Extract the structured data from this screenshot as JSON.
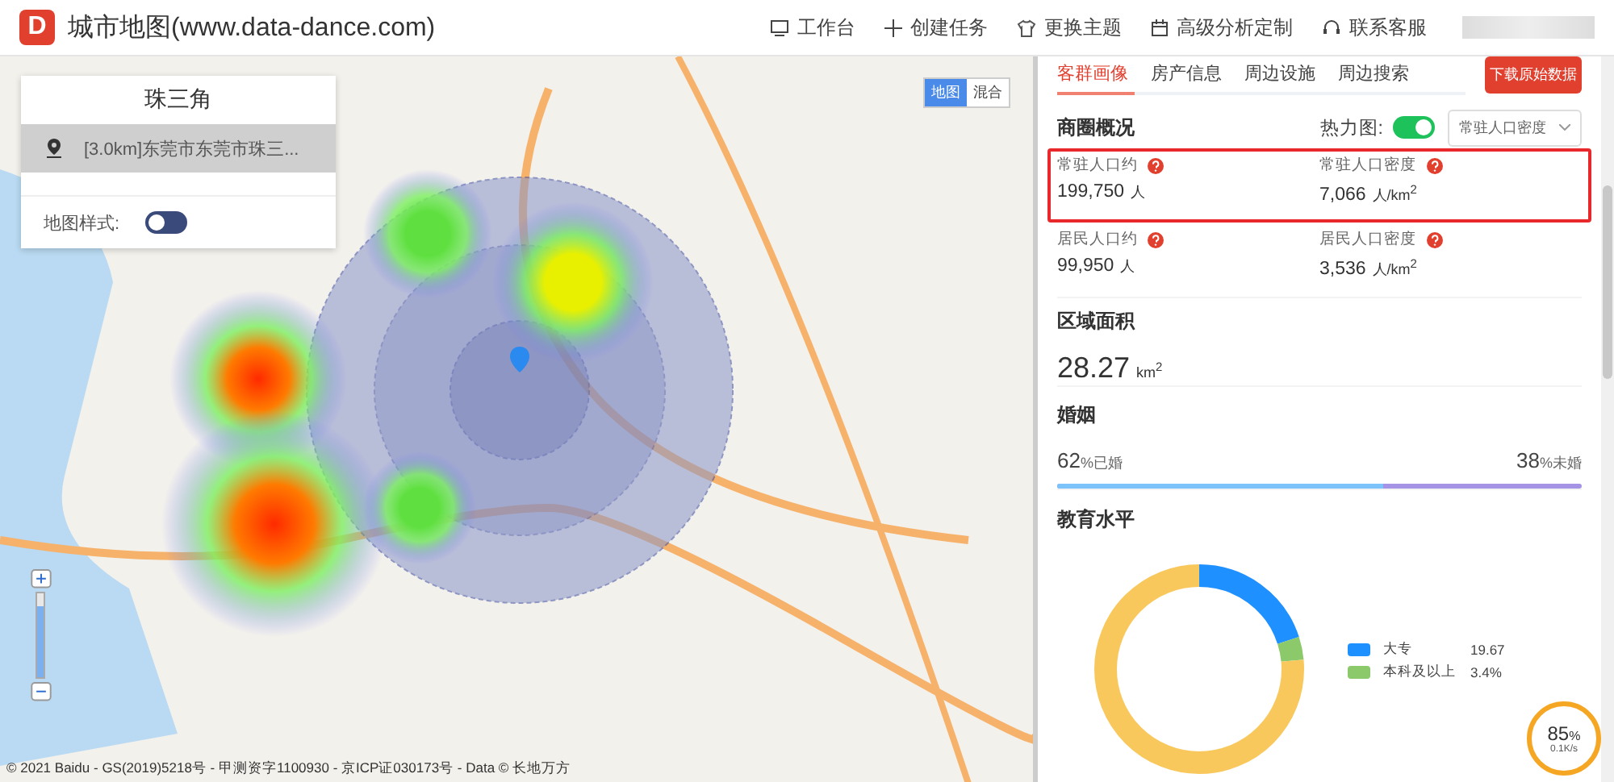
{
  "header": {
    "logo": "D",
    "title": "城市地图(www.data-dance.com)",
    "nav": [
      {
        "kind": "monitor",
        "label": "工作台"
      },
      {
        "kind": "plus",
        "label": "创建任务"
      },
      {
        "kind": "shirt",
        "label": "更换主题"
      },
      {
        "kind": "calendar",
        "label": "高级分析定制"
      },
      {
        "kind": "headset",
        "label": "联系客服"
      }
    ]
  },
  "map_panel": {
    "title": "珠三角",
    "items": [
      {
        "label": "[3.0km]东莞市东莞市珠三...",
        "selected": true
      }
    ],
    "style_label": "地图样式:",
    "style_toggle": {
      "on": false
    }
  },
  "zoom": {
    "level": 0.85
  },
  "map_type": [
    {
      "label": "地图",
      "selected": true
    },
    {
      "label": "混合",
      "selected": false
    }
  ],
  "copyright": "© 2021 Baidu - GS(2019)5218号 - 甲测资字1100930 - 京ICP证030173号 - Data © 长地万方",
  "sidebar": {
    "tabs": [
      {
        "label": "客群画像",
        "selected": true
      },
      {
        "label": "房产信息",
        "selected": false
      },
      {
        "label": "周边设施",
        "selected": false
      },
      {
        "label": "周边搜索",
        "selected": false
      }
    ],
    "download": "下载原始数据",
    "overview": {
      "title": "商圈概况",
      "heat_label": "热力图:",
      "heat_toggle": {
        "on": true
      },
      "heat_select": "常驻人口密度",
      "stats": [
        {
          "label": "常驻人口约",
          "value": "199,750",
          "unit": "人",
          "highlighted": true
        },
        {
          "label": "常驻人口密度",
          "value": "7,066",
          "unit": "人/km$^{2}$",
          "highlighted": true
        },
        {
          "label": "居民人口约",
          "value": "99,950",
          "unit": "人",
          "highlighted": false
        },
        {
          "label": "居民人口密度",
          "value": "3,536",
          "unit": "人/km$^{2}$",
          "highlighted": false
        }
      ]
    },
    "area": {
      "title": "区域面积",
      "value": "28.27",
      "unit": "km$^{2}$"
    },
    "marriage": {
      "title": "婚姻",
      "left_value": "62",
      "left_label": "%已婚",
      "right_value": "38",
      "right_label": "%未婚",
      "level": 0.62
    },
    "education": {
      "title": "教育水平",
      "legend": [
        {
          "label": "大专",
          "value": "19.67",
          "color": "#1e90ff"
        },
        {
          "label": "本科及以上",
          "value": "3.4%",
          "color": "#8cc96a"
        }
      ]
    }
  },
  "speed_widget": {
    "percent": "85",
    "unit": "%",
    "rate": "0.1K/s"
  }
}
